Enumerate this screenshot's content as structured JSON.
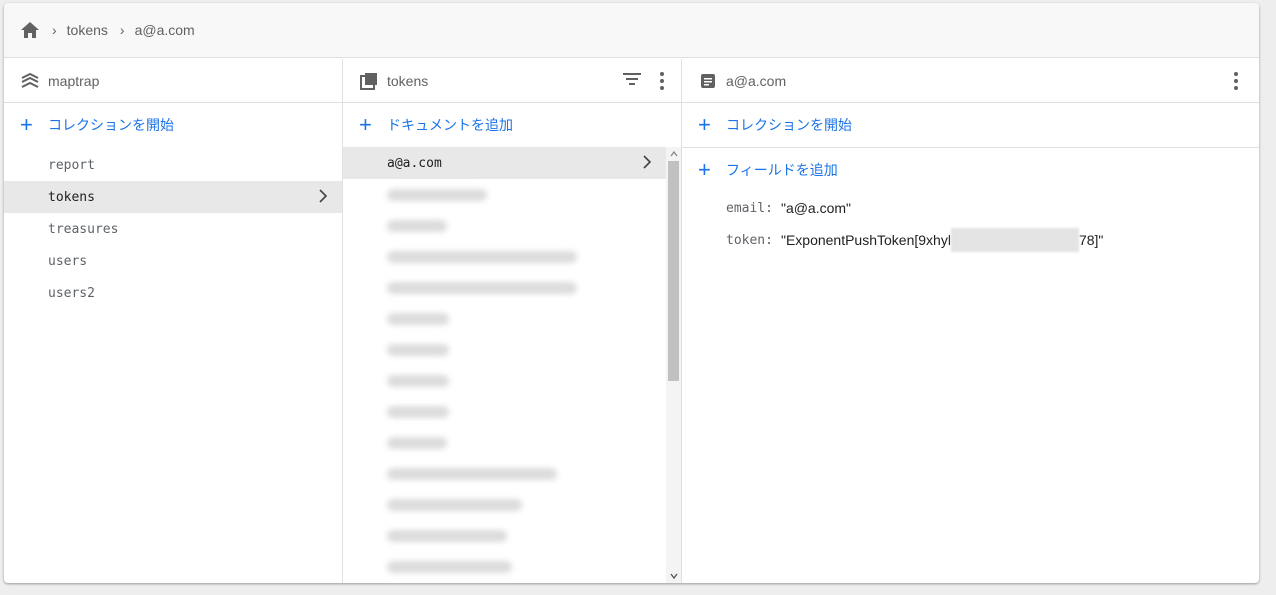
{
  "breadcrumb": {
    "items": [
      "tokens",
      "a@a.com"
    ]
  },
  "collections_panel": {
    "title": "maptrap",
    "add_label": "コレクションを開始",
    "items": [
      "report",
      "tokens",
      "treasures",
      "users",
      "users2"
    ],
    "selected": "tokens"
  },
  "documents_panel": {
    "title": "tokens",
    "add_label": "ドキュメントを追加",
    "selected_doc": "a@a.com"
  },
  "document_panel": {
    "title": "a@a.com",
    "add_collection_label": "コレクションを開始",
    "add_field_label": "フィールドを追加",
    "fields": [
      {
        "key": "email:",
        "value": "\"a@a.com\""
      },
      {
        "key": "token:",
        "value_prefix": "\"ExponentPushToken[9xhyl",
        "value_suffix": "78]\""
      }
    ]
  },
  "colors": {
    "accent": "#1a73e8",
    "selected_bg": "#e8e8e8",
    "breadcrumb_bg": "#f8f8f8"
  }
}
